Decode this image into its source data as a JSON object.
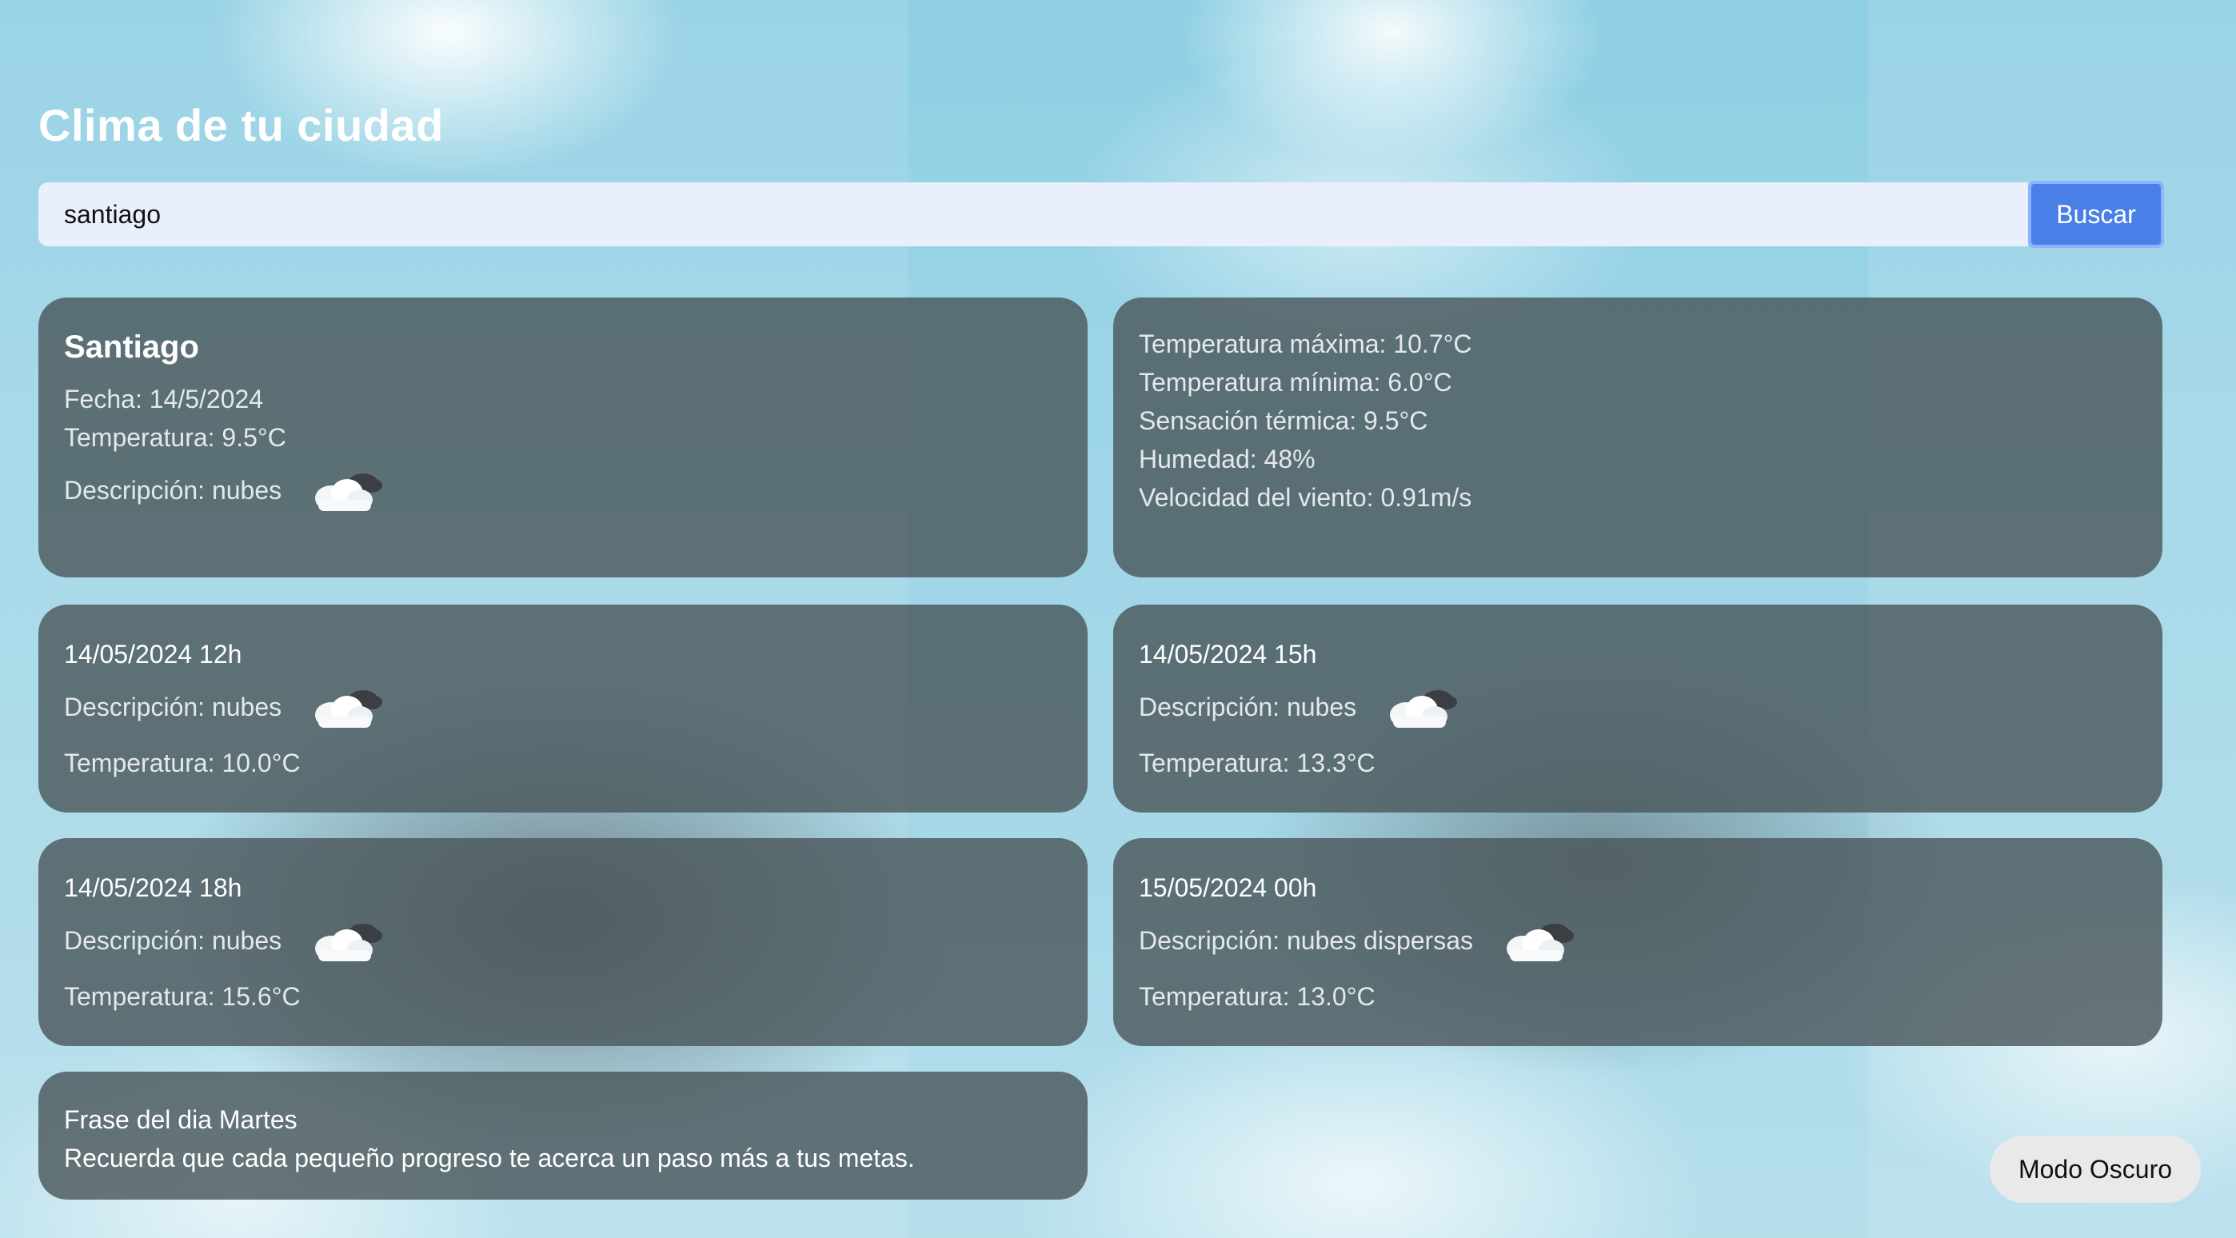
{
  "header": {
    "title": "Clima de tu ciudad"
  },
  "search": {
    "value": "santiago",
    "button_label": "Buscar"
  },
  "current": {
    "city": "Santiago",
    "date": "Fecha: 14/5/2024",
    "temperature": "Temperatura: 9.5°C",
    "description": "Descripción: nubes",
    "icon": "cloud-icon"
  },
  "details": {
    "max_temp": "Temperatura máxima: 10.7°C",
    "min_temp": "Temperatura mínima: 6.0°C",
    "feels_like": "Sensación térmica: 9.5°C",
    "humidity": "Humedad: 48%",
    "wind_speed": "Velocidad del viento: 0.91m/s"
  },
  "forecast": [
    {
      "datetime": "14/05/2024 12h",
      "description": "Descripción: nubes",
      "temperature": "Temperatura: 10.0°C",
      "icon": "cloud-icon"
    },
    {
      "datetime": "14/05/2024 15h",
      "description": "Descripción: nubes",
      "temperature": "Temperatura: 13.3°C",
      "icon": "cloud-icon"
    },
    {
      "datetime": "14/05/2024 18h",
      "description": "Descripción: nubes",
      "temperature": "Temperatura: 15.6°C",
      "icon": "cloud-icon"
    },
    {
      "datetime": "15/05/2024 00h",
      "description": "Descripción: nubes dispersas",
      "temperature": "Temperatura: 13.0°C",
      "icon": "cloud-icon"
    }
  ],
  "quote": {
    "title": "Frase del dia Martes",
    "text": "Recuerda que cada pequeño progreso te acerca un paso más a tus metas."
  },
  "theme_toggle": {
    "label": "Modo Oscuro"
  },
  "colors": {
    "accent": "#4a7fe8",
    "card_background": "#4b585c",
    "input_background": "#e9effc"
  }
}
